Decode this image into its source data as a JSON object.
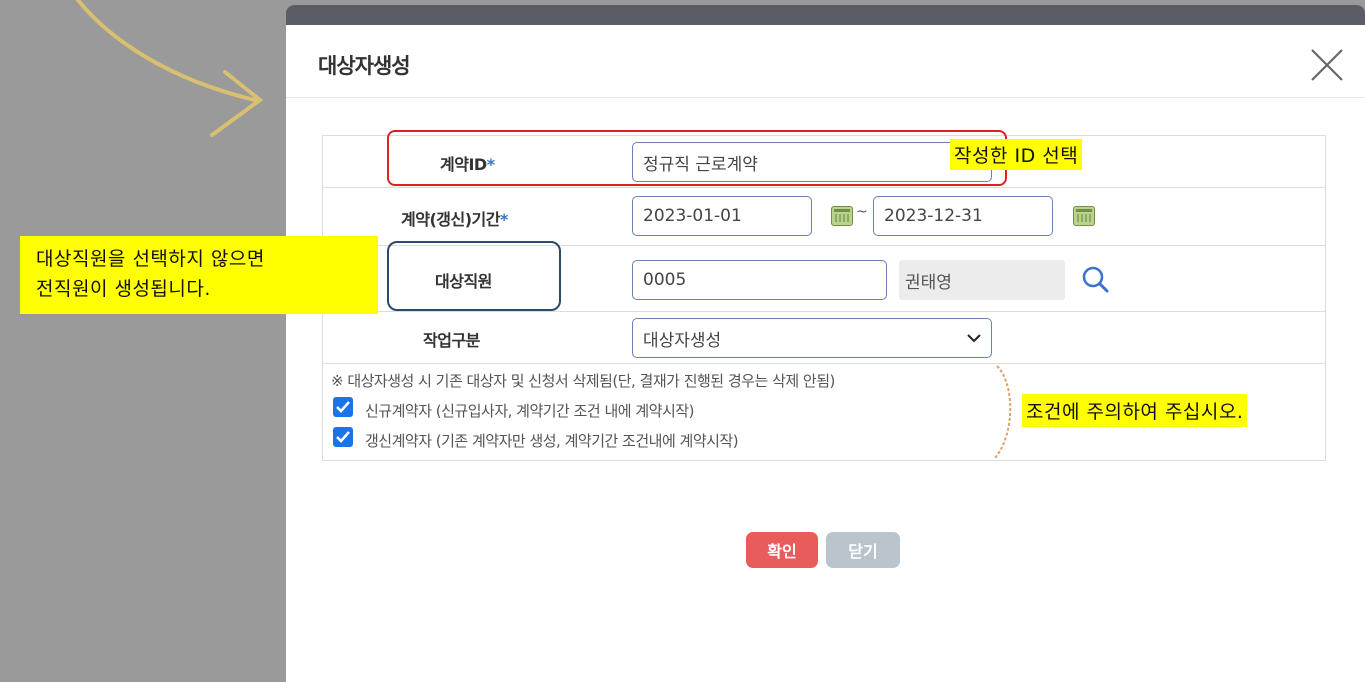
{
  "dialog": {
    "title": "대상자생성"
  },
  "form": {
    "contract_id": {
      "label": "계약ID",
      "required_mark": "*",
      "value": "정규직 근로계약"
    },
    "period": {
      "label": "계약(갱신)기간",
      "required_mark": "*",
      "start": "2023-01-01",
      "separator": "~",
      "end": "2023-12-31"
    },
    "employee": {
      "label": "대상직원",
      "code": "0005",
      "name": "권태영"
    },
    "work_type": {
      "label": "작업구분",
      "selected": "대상자생성"
    },
    "notice": "※ 대상자생성 시 기존 대상자 및 신청서 삭제됨(단, 결재가 진행된 경우는 삭제 안됨)",
    "checkboxes": [
      {
        "label": "신규계약자 (신규입사자, 계약기간 조건 내에 계약시작)",
        "checked": true
      },
      {
        "label": "갱신계약자 (기존 계약자만 생성, 계약기간 조건내에 계약시작)",
        "checked": true
      }
    ]
  },
  "buttons": {
    "confirm": "확인",
    "close": "닫기"
  },
  "annotations": {
    "id_select": "작성한 ID 선택",
    "employee_note_line1": "대상직원을 선택하지 않으면",
    "employee_note_line2": "전직원이 생성됩니다.",
    "condition_note": "조건에 주의하여 주십시오."
  },
  "colors": {
    "confirm_button": "#e85c5c",
    "close_button": "#b9c4cc",
    "highlight_yellow": "#ffff00",
    "highlight_red": "#dd2222",
    "checkbox_blue": "#1a73e8"
  }
}
